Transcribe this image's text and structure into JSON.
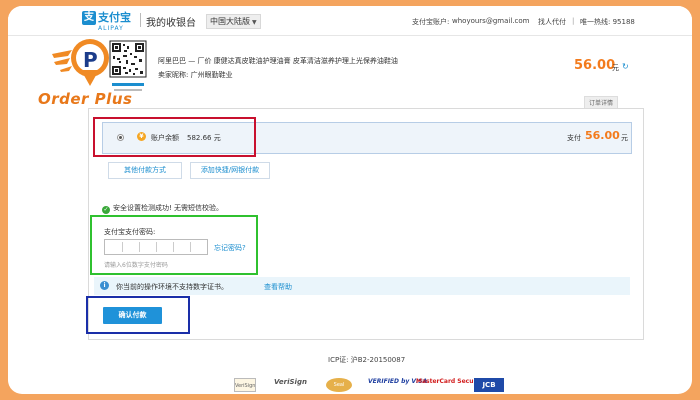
{
  "header": {
    "alipay_logo_cn": "支付宝",
    "alipay_logo_en": "ALIPAY",
    "cashier_title": "我的收银台",
    "region": "中国大陆版",
    "account_label": "支付宝账户:",
    "account_email": "whoyours@gmail.com",
    "link_agent_pay": "找人代付",
    "hotline": "唯一热线: 95188"
  },
  "overlay_logo": {
    "text": "Order Plus"
  },
  "order": {
    "description": "阿里巴巴 — 厂价 康健达真皮鞋油护理油膏 皮革清洁滋养护理上光保养油鞋油",
    "seller": "卖家昵称: 广州眼勤鞋业",
    "amount": "56.00",
    "amount_unit": "元",
    "order_detail_tab": "订单详情"
  },
  "payment": {
    "balance_label": "账户余额",
    "balance_value": "582.66 元",
    "pay_label": "支付",
    "pay_amount": "56.00",
    "pay_unit": "元",
    "other_methods_button": "其他付款方式",
    "add_bank_button": "添加快捷/网银付款",
    "security_check": "安全设置检测成功! 无需短信校验。",
    "password_label": "支付宝支付密码:",
    "forgot_password": "忘记密码?",
    "password_hint": "请输入6位数字支付密码",
    "notice_text": "你当前的操作环境不支持数字证书。",
    "notice_help": "查看帮助",
    "confirm_button": "确认付款"
  },
  "footer": {
    "icp": "ICP证: 沪B2-20150087",
    "logos": [
      "VeriSign",
      "VeriSign",
      "Seal",
      "VERIFIED by VISA",
      "MasterCard SecureCode",
      "JCB"
    ]
  }
}
